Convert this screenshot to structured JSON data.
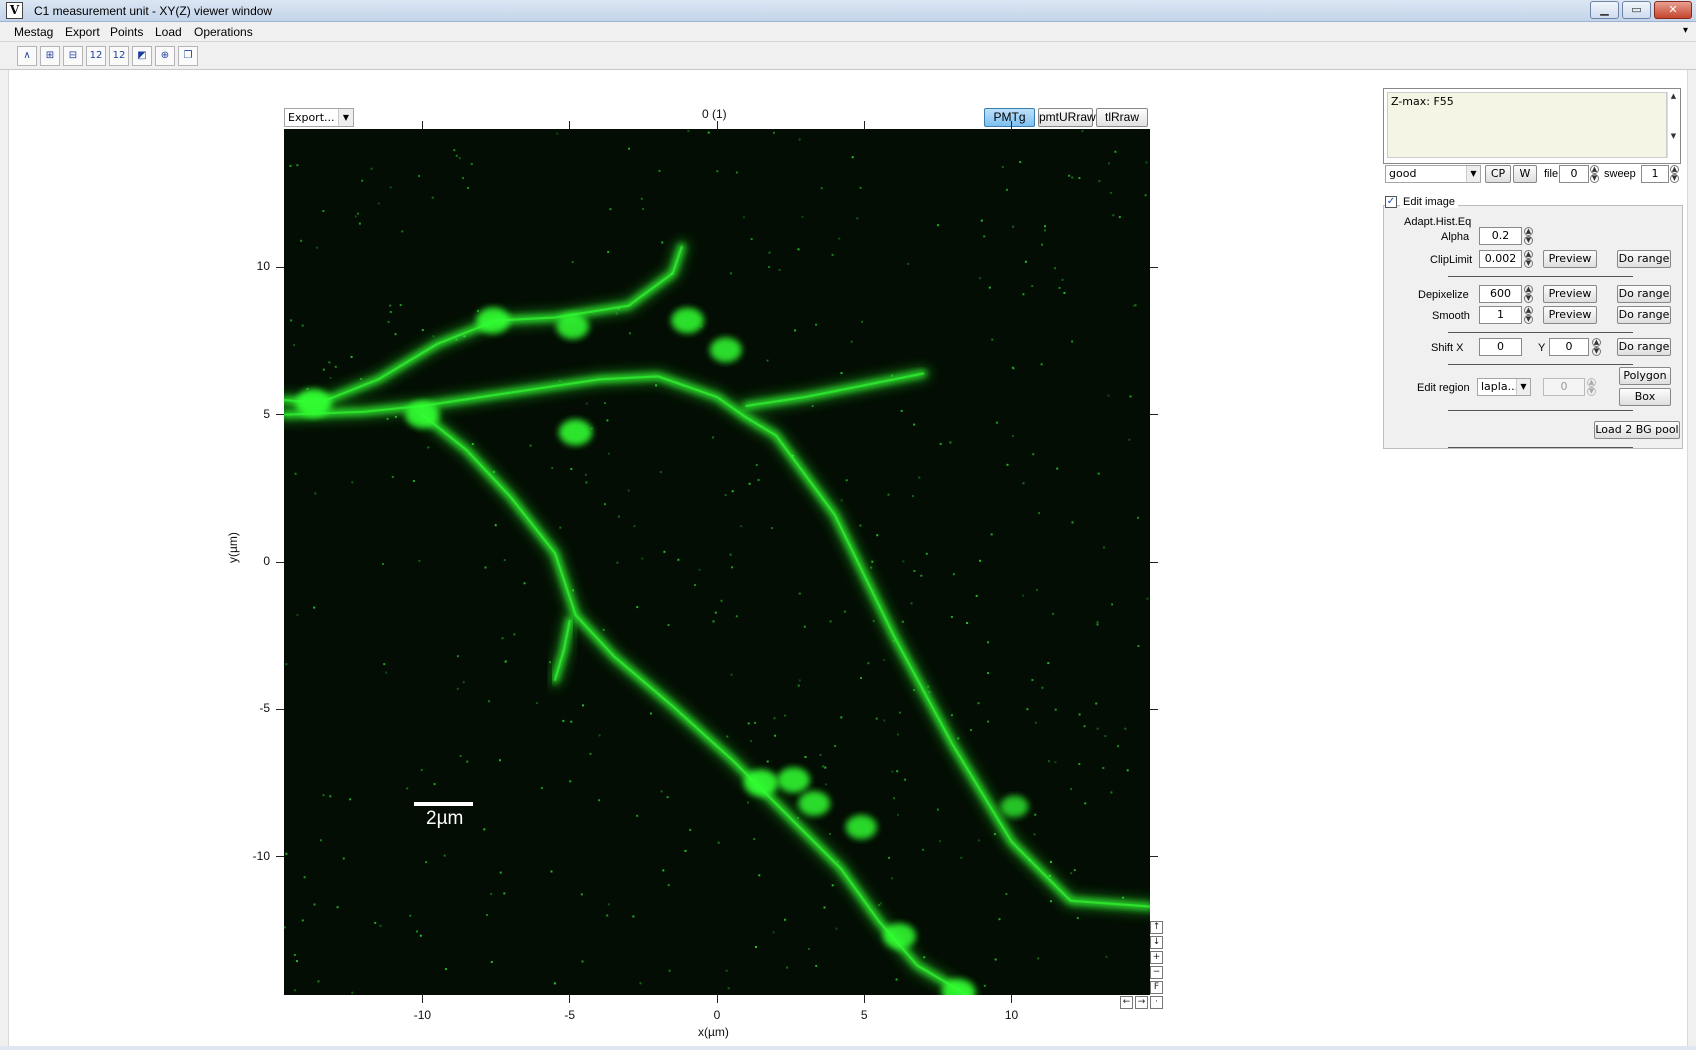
{
  "window": {
    "app_icon_letter": "V",
    "title": "C1  measurement unit - XY(Z) viewer window",
    "minimize": "▁",
    "maximize": "▭",
    "close": "✕"
  },
  "menu": {
    "items": [
      "Mestag",
      "Export",
      "Points",
      "Load",
      "Operations"
    ],
    "corner_glyph": "▾"
  },
  "toolbar": {
    "tools": [
      {
        "icon": "curve-tool-icon",
        "glyph": "∧"
      },
      {
        "icon": "box-select-icon",
        "glyph": "⊞"
      },
      {
        "icon": "vertical-select-icon",
        "glyph": "⊟"
      },
      {
        "icon": "number-range-icon",
        "glyph": "12"
      },
      {
        "icon": "number-format-icon",
        "glyph": "12"
      },
      {
        "icon": "chart-edit-icon",
        "glyph": "◩"
      },
      {
        "icon": "crosshair-icon",
        "glyph": "⊕"
      },
      {
        "icon": "copy-icon",
        "glyph": "❐"
      }
    ]
  },
  "viewer": {
    "export_select": "Export...",
    "frame_label": "0 (1)",
    "channels": [
      {
        "label": "PMTg",
        "active": true
      },
      {
        "label": "pmtURraw",
        "active": false
      },
      {
        "label": "tlRraw",
        "active": false
      }
    ],
    "x_label": "x(µm)",
    "y_label": "y(µm)",
    "scale_bar_label": "2µm",
    "nav_buttons": [
      "↑",
      "↓",
      "+",
      "−",
      "F"
    ],
    "nav_buttons_bottom": [
      "←",
      "→",
      "·"
    ]
  },
  "chart_data": {
    "type": "heatmap",
    "title": "0 (1)",
    "xlabel": "x(µm)",
    "ylabel": "y(µm)",
    "xlim": [
      -14.7,
      14.7
    ],
    "ylim": [
      -14.7,
      14.7
    ],
    "x_ticks": [
      -10,
      -5,
      0,
      5,
      10
    ],
    "y_ticks": [
      10,
      5,
      0,
      -5,
      -10
    ],
    "x_tick_labels": [
      "-10",
      "-5",
      "0",
      "5",
      "10"
    ],
    "y_tick_labels": [
      "10",
      "5",
      "0",
      "-5",
      "-10"
    ],
    "colormap": "green on black",
    "background_color": "#030d03",
    "signal_color": "#33ff33",
    "scale_bar_um": 2,
    "dendrites": [
      [
        [
          -14.7,
          5.5
        ],
        [
          -13.5,
          5.4
        ],
        [
          -11.5,
          6.2
        ],
        [
          -9.5,
          7.4
        ],
        [
          -7.5,
          8.2
        ],
        [
          -5.5,
          8.3
        ],
        [
          -3,
          8.7
        ],
        [
          -1.5,
          9.8
        ],
        [
          -1.2,
          10.7
        ]
      ],
      [
        [
          -14.7,
          5.0
        ],
        [
          -12,
          5.1
        ],
        [
          -10,
          5.3
        ],
        [
          -8,
          5.6
        ],
        [
          -6,
          5.9
        ],
        [
          -4,
          6.2
        ],
        [
          -2,
          6.3
        ],
        [
          0,
          5.6
        ],
        [
          1,
          4.9
        ],
        [
          2,
          4.3
        ],
        [
          4,
          1.6
        ],
        [
          6,
          -2.5
        ],
        [
          8,
          -6.2
        ],
        [
          10,
          -9.5
        ],
        [
          12,
          -11.5
        ],
        [
          14.7,
          -11.7
        ]
      ],
      [
        [
          -10,
          5.0
        ],
        [
          -8.5,
          3.8
        ],
        [
          -7,
          2.2
        ],
        [
          -5.5,
          0.3
        ],
        [
          -4.8,
          -1.8
        ],
        [
          -3.5,
          -3.2
        ],
        [
          -1.5,
          -4.9
        ],
        [
          0.5,
          -6.7
        ],
        [
          2.5,
          -8.7
        ],
        [
          4.2,
          -10.4
        ],
        [
          5.5,
          -12.2
        ],
        [
          6.8,
          -13.7
        ],
        [
          8.5,
          -14.7
        ]
      ],
      [
        [
          1,
          5.3
        ],
        [
          3,
          5.6
        ],
        [
          5,
          6.0
        ],
        [
          7,
          6.4
        ]
      ],
      [
        [
          -5,
          -2
        ],
        [
          -5.2,
          -3
        ],
        [
          -5.5,
          -4
        ]
      ]
    ],
    "bright_spots": [
      {
        "x": -13.7,
        "y": 5.4,
        "intensity": 1
      },
      {
        "x": -10,
        "y": 5.0,
        "intensity": 0.9
      },
      {
        "x": -7.6,
        "y": 8.2,
        "intensity": 0.85
      },
      {
        "x": -4.9,
        "y": 8.0,
        "intensity": 0.8
      },
      {
        "x": -1,
        "y": 8.2,
        "intensity": 0.8
      },
      {
        "x": 0.3,
        "y": 7.2,
        "intensity": 0.75
      },
      {
        "x": -4.8,
        "y": 4.4,
        "intensity": 0.85
      },
      {
        "x": 1.5,
        "y": -7.5,
        "intensity": 0.9
      },
      {
        "x": 2.6,
        "y": -7.4,
        "intensity": 0.8
      },
      {
        "x": 3.3,
        "y": -8.2,
        "intensity": 0.75
      },
      {
        "x": 4.9,
        "y": -9.0,
        "intensity": 0.7
      },
      {
        "x": 6.2,
        "y": -12.7,
        "intensity": 0.8
      },
      {
        "x": 8.2,
        "y": -14.6,
        "intensity": 0.85
      },
      {
        "x": 10.1,
        "y": -8.3,
        "intensity": 0.5
      }
    ]
  },
  "panel": {
    "info_text": "Z-max: F55",
    "status_select": "good",
    "cp_button": "CP",
    "w_button": "W",
    "file_label": "file",
    "file_value": "0",
    "sweep_label": "sweep",
    "sweep_value": "1",
    "edit_image_label": "Edit image",
    "edit_image_checked": true,
    "adapt_label": "Adapt.Hist.Eq",
    "alpha_label": "Alpha",
    "alpha_value": "0.2",
    "cliplimit_label": "ClipLimit",
    "cliplimit_value": "0.002",
    "depixelize_label": "Depixelize",
    "depixelize_value": "600",
    "smooth_label": "Smooth",
    "smooth_value": "1",
    "shift_label": "Shift  X",
    "shift_x_value": "0",
    "shift_y_label": "Y",
    "shift_y_value": "0",
    "edit_region_label": "Edit region",
    "edit_region_select": "lapla...",
    "edit_region_value": "0",
    "preview_label": "Preview",
    "do_range_label": "Do range",
    "polygon_label": "Polygon",
    "box_label": "Box",
    "load_bg_label": "Load 2 BG pool"
  }
}
